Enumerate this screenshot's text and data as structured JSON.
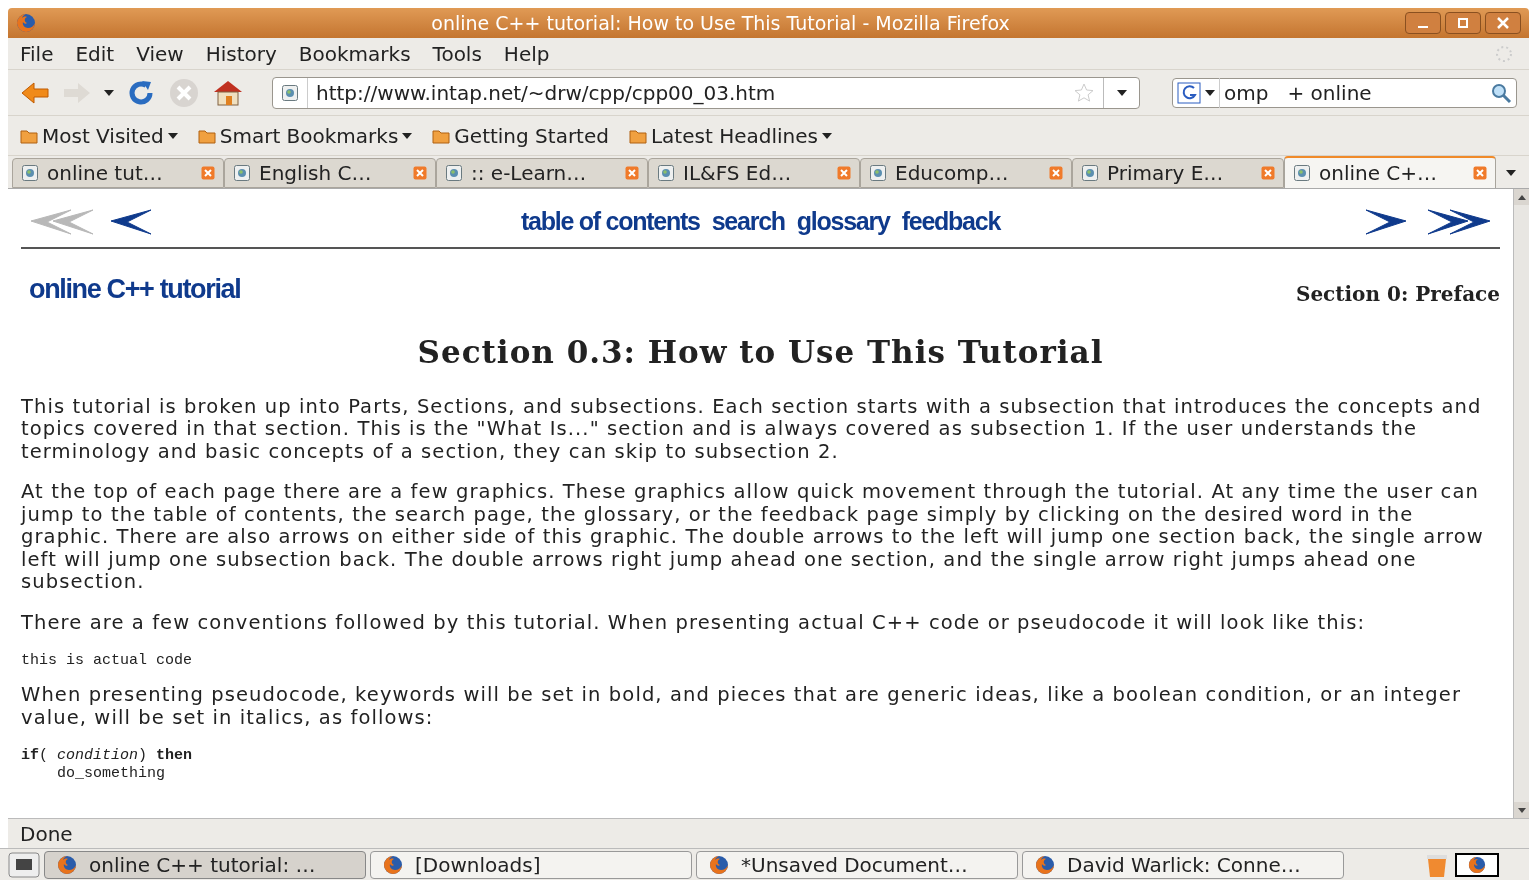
{
  "window": {
    "title": "online C++ tutorial: How to Use This Tutorial - Mozilla Firefox"
  },
  "menu": [
    "File",
    "Edit",
    "View",
    "History",
    "Bookmarks",
    "Tools",
    "Help"
  ],
  "toolbar": {
    "url": "http://www.intap.net/~drw/cpp/cpp00_03.htm",
    "search": "omp   + online"
  },
  "bookmarks": [
    {
      "label": "Most Visited",
      "dropdown": true
    },
    {
      "label": "Smart Bookmarks",
      "dropdown": true
    },
    {
      "label": "Getting Started",
      "dropdown": false
    },
    {
      "label": "Latest Headlines",
      "dropdown": true
    }
  ],
  "tabs": [
    {
      "label": "online tut…",
      "selected": false
    },
    {
      "label": "English C…",
      "selected": false
    },
    {
      "label": ":: e-Learn…",
      "selected": false
    },
    {
      "label": "IL&FS Ed…",
      "selected": false
    },
    {
      "label": "Educomp…",
      "selected": false
    },
    {
      "label": "Primary E…",
      "selected": false
    },
    {
      "label": "online C+…",
      "selected": true
    }
  ],
  "page": {
    "nav_arrows": [
      {
        "kind": "double-left",
        "disabled": true
      },
      {
        "kind": "single-left",
        "disabled": false
      },
      {
        "kind": "single-right",
        "disabled": false
      },
      {
        "kind": "double-right",
        "disabled": false
      }
    ],
    "nav_links": [
      "table of contents",
      "search",
      "glossary",
      "feedback"
    ],
    "logo": "online C++ tutorial",
    "section": "Section 0: Preface",
    "heading": "Section 0.3: How to Use This Tutorial",
    "blocks": [
      {
        "kind": "text",
        "text": "This tutorial is broken up into Parts, Sections, and subsections. Each section starts with a subsection that introduces the concepts and topics covered in that section. This is the \"What Is...\" section and is always covered as subsection 1. If the user understands the terminology and basic concepts of a section, they can skip to subsection 2."
      },
      {
        "kind": "text",
        "text": "At the top of each page there are a few graphics. These graphics allow quick movement through the tutorial. At any time the user can jump to the table of contents, the search page, the glossary, or the feedback page simply by clicking on the desired word in the graphic. There are also arrows on either side of this graphic. The double arrows to the left will jump one section back, the single arrow left will jump one subsection back. The double arrows right jump ahead one section, and the single arrow right jumps ahead one subsection."
      },
      {
        "kind": "text",
        "text": "There are a few conventions followed by this tutorial. When presenting actual C++ code or pseudocode it will look like this:"
      },
      {
        "kind": "code",
        "lines": [
          "this is actual code"
        ]
      },
      {
        "kind": "text",
        "text": "When presenting pseudocode, keywords will be set in bold, and pieces that are generic ideas, like a boolean condition, or an integer value, will be set in italics, as follows:"
      },
      {
        "kind": "code",
        "lines": [
          "**if**( *condition*) **then**",
          "    do_something"
        ]
      }
    ]
  },
  "status": "Done",
  "taskbar": [
    {
      "label": "online C++ tutorial: …",
      "selected": true
    },
    {
      "label": "[Downloads]",
      "selected": false
    },
    {
      "label": "*Unsaved Document…",
      "selected": false
    },
    {
      "label": "David Warlick: Conne…",
      "selected": false
    }
  ]
}
